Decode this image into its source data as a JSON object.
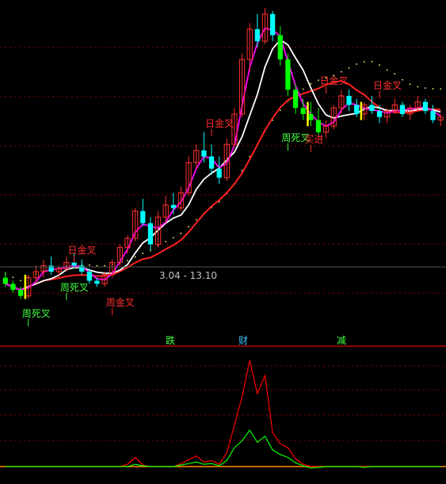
{
  "colors": {
    "background": "#000000",
    "grid": "#8b0000",
    "divider": "#c00000",
    "candle_up": "#ff3030",
    "candle_down": "#00ffff",
    "ma_short": "#ff00ff",
    "ma_mid": "#ffffff",
    "ma_long": "#ff2020",
    "dotted": "#ffff80",
    "green_bar": "#00ff00",
    "yellow_bar": "#ffff00",
    "osc_red": "#ff0000",
    "osc_green": "#00ff00",
    "osc_baseline": "#ff8c00",
    "price_text": "#c0c0c0",
    "signal_red": "#ff3030",
    "signal_green": "#40ff40"
  },
  "top_panel": {
    "price_range_label": "3.04 - 13.10"
  },
  "divider_labels": [
    {
      "text": "跌",
      "color": "#40ff40"
    },
    {
      "text": "财",
      "color": "#40c0ff"
    },
    {
      "text": "减",
      "color": "#40ff40"
    }
  ],
  "chart_data": [
    {
      "type": "candlestick",
      "title": "",
      "price_range": [
        3.04,
        13.1
      ],
      "x": [
        1,
        2,
        3,
        4,
        5,
        6,
        7,
        8,
        9,
        10,
        11,
        12,
        13,
        14,
        15,
        16,
        17,
        18,
        19,
        20,
        21,
        22,
        23,
        24,
        25,
        26,
        27,
        28,
        29,
        30,
        31,
        32,
        33,
        34,
        35,
        36,
        37,
        38,
        39,
        40,
        41,
        42,
        43,
        44,
        45,
        46,
        47,
        48,
        49,
        50,
        51,
        52,
        53,
        54,
        55,
        56,
        57,
        58,
        59,
        60,
        61,
        62,
        63,
        64,
        65,
        66,
        67,
        68,
        69,
        70
      ],
      "ohlc": [
        [
          4.2,
          4.4,
          3.9,
          4.0
        ],
        [
          4.0,
          4.1,
          3.7,
          3.8
        ],
        [
          3.8,
          3.9,
          3.5,
          3.6
        ],
        [
          3.6,
          4.3,
          3.5,
          4.2
        ],
        [
          4.2,
          4.6,
          4.0,
          4.4
        ],
        [
          4.4,
          4.8,
          4.2,
          4.6
        ],
        [
          4.6,
          4.9,
          4.3,
          4.4
        ],
        [
          4.4,
          4.6,
          4.2,
          4.5
        ],
        [
          4.5,
          4.9,
          4.4,
          4.7
        ],
        [
          4.7,
          5.0,
          4.5,
          4.6
        ],
        [
          4.6,
          4.8,
          4.3,
          4.4
        ],
        [
          4.4,
          4.5,
          4.0,
          4.1
        ],
        [
          4.1,
          4.2,
          3.9,
          4.0
        ],
        [
          4.0,
          4.4,
          3.9,
          4.3
        ],
        [
          4.3,
          4.8,
          4.2,
          4.7
        ],
        [
          4.7,
          5.3,
          4.6,
          5.2
        ],
        [
          5.2,
          5.6,
          5.0,
          5.5
        ],
        [
          5.5,
          6.5,
          5.4,
          6.4
        ],
        [
          6.4,
          6.8,
          5.9,
          6.0
        ],
        [
          6.0,
          6.2,
          5.1,
          5.3
        ],
        [
          5.3,
          6.4,
          5.2,
          6.2
        ],
        [
          6.2,
          6.9,
          6.0,
          6.6
        ],
        [
          6.6,
          7.0,
          6.3,
          6.5
        ],
        [
          6.5,
          7.2,
          6.4,
          7.0
        ],
        [
          7.0,
          8.2,
          6.9,
          8.0
        ],
        [
          8.0,
          8.6,
          7.8,
          8.4
        ],
        [
          8.4,
          9.0,
          8.0,
          8.2
        ],
        [
          8.2,
          8.6,
          7.6,
          7.8
        ],
        [
          7.8,
          8.2,
          7.3,
          7.5
        ],
        [
          7.5,
          8.8,
          7.4,
          8.6
        ],
        [
          8.6,
          9.8,
          8.5,
          9.6
        ],
        [
          9.6,
          11.6,
          9.5,
          11.4
        ],
        [
          11.4,
          12.6,
          11.0,
          12.4
        ],
        [
          12.4,
          12.9,
          11.8,
          12.0
        ],
        [
          12.0,
          13.1,
          11.9,
          12.9
        ],
        [
          12.9,
          13.0,
          12.0,
          12.2
        ],
        [
          12.2,
          12.5,
          11.2,
          11.4
        ],
        [
          11.4,
          11.6,
          10.2,
          10.4
        ],
        [
          10.4,
          10.6,
          9.6,
          9.8
        ],
        [
          9.8,
          10.1,
          9.4,
          9.6
        ],
        [
          9.6,
          10.0,
          9.2,
          9.4
        ],
        [
          9.4,
          9.8,
          8.9,
          9.0
        ],
        [
          9.0,
          9.4,
          8.8,
          9.2
        ],
        [
          9.2,
          9.9,
          9.1,
          9.8
        ],
        [
          9.8,
          10.4,
          9.6,
          10.2
        ],
        [
          10.2,
          10.4,
          9.7,
          9.9
        ],
        [
          9.9,
          10.1,
          9.5,
          9.6
        ],
        [
          9.6,
          10.0,
          9.4,
          9.9
        ],
        [
          9.9,
          10.2,
          9.6,
          9.7
        ],
        [
          9.7,
          9.9,
          9.3,
          9.5
        ],
        [
          9.5,
          9.8,
          9.3,
          9.7
        ],
        [
          9.7,
          10.1,
          9.6,
          9.9
        ],
        [
          9.9,
          10.0,
          9.5,
          9.6
        ],
        [
          9.6,
          9.9,
          9.4,
          9.8
        ],
        [
          9.8,
          10.2,
          9.7,
          10.0
        ],
        [
          10.0,
          10.1,
          9.6,
          9.7
        ],
        [
          9.7,
          9.9,
          9.3,
          9.4
        ],
        [
          9.4,
          9.6,
          9.2,
          9.5
        ]
      ],
      "signals": [
        {
          "text": "日金叉",
          "x": 9,
          "color": "#ff3030"
        },
        {
          "text": "周死叉",
          "x": 8,
          "color": "#40ff40"
        },
        {
          "text": "周金叉",
          "x": 14,
          "color": "#ff3030"
        },
        {
          "text": "周死叉",
          "x": 3,
          "color": "#40ff40"
        },
        {
          "text": "日金叉",
          "x": 27,
          "color": "#ff3030"
        },
        {
          "text": "周死叉",
          "x": 37,
          "color": "#40ff40"
        },
        {
          "text": "买进",
          "x": 40,
          "color": "#ff3030"
        },
        {
          "text": "日金叉",
          "x": 42,
          "color": "#ff3030"
        },
        {
          "text": "日金叉",
          "x": 49,
          "color": "#ff3030"
        }
      ]
    },
    {
      "type": "line",
      "title": "",
      "series": [
        {
          "color": "#ff0000",
          "values": [
            0,
            0,
            0,
            0,
            0,
            0,
            0,
            0,
            0,
            0,
            0,
            0,
            0,
            0,
            0,
            0,
            3,
            12,
            2,
            0,
            0,
            0,
            0,
            4,
            9,
            14,
            6,
            8,
            3,
            18,
            55,
            92,
            140,
            96,
            120,
            45,
            30,
            25,
            10,
            3,
            0,
            0,
            0,
            0,
            0,
            0,
            0,
            0,
            0,
            0,
            0,
            0,
            0,
            0,
            0,
            0,
            0,
            0
          ]
        },
        {
          "color": "#00ff00",
          "values": [
            0,
            0,
            0,
            0,
            0,
            0,
            0,
            0,
            0,
            0,
            0,
            0,
            0,
            0,
            0,
            0,
            0,
            3,
            1,
            0,
            0,
            0,
            0,
            2,
            4,
            6,
            3,
            4,
            1,
            8,
            25,
            34,
            48,
            32,
            40,
            22,
            16,
            12,
            5,
            1,
            -2,
            -1,
            0,
            0,
            0,
            0,
            0,
            -1,
            0,
            0,
            0,
            0,
            0,
            0,
            0,
            0,
            0,
            0
          ]
        }
      ]
    }
  ]
}
